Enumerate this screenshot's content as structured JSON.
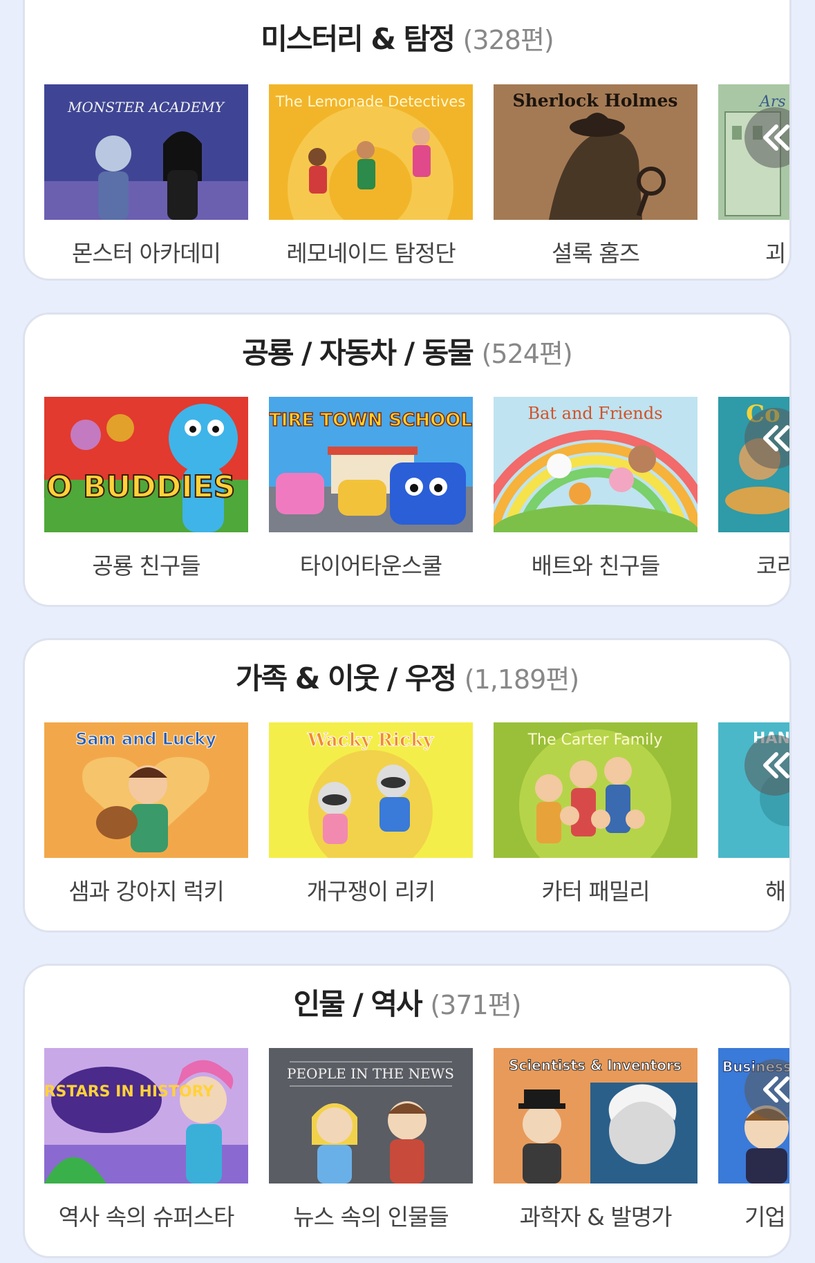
{
  "sections": [
    {
      "title": "미스터리 & 탐정",
      "count": "(328편)",
      "items": [
        {
          "label": "몬스터 아카데미",
          "thumb_text": "MONSTER ACADEMY"
        },
        {
          "label": "레모네이드 탐정단",
          "thumb_text": "The Lemonade Detectives"
        },
        {
          "label": "셜록 홈즈",
          "thumb_text": "Sherlock Holmes"
        },
        {
          "label": "괴",
          "thumb_text": "Ars"
        }
      ]
    },
    {
      "title": "공룡 / 자동차 / 동물",
      "count": "(524편)",
      "items": [
        {
          "label": "공룡 친구들",
          "thumb_text": "DINO BUDDIES"
        },
        {
          "label": "타이어타운스쿨",
          "thumb_text": "TIRE TOWN SCHOOL"
        },
        {
          "label": "배트와 친구들",
          "thumb_text": "Bat and Friends"
        },
        {
          "label": "코리",
          "thumb_text": "Co"
        }
      ]
    },
    {
      "title": "가족 & 이웃 / 우정",
      "count": "(1,189편)",
      "items": [
        {
          "label": "샘과 강아지 럭키",
          "thumb_text": "Sam and Lucky"
        },
        {
          "label": "개구쟁이 리키",
          "thumb_text": "Wacky Ricky"
        },
        {
          "label": "카터 패밀리",
          "thumb_text": "The Carter Family"
        },
        {
          "label": "해",
          "thumb_text": "HAN"
        }
      ]
    },
    {
      "title": "인물 / 역사",
      "count": "(371편)",
      "items": [
        {
          "label": "역사 속의 슈퍼스타",
          "thumb_text": "SUPERSTARS IN HISTORY"
        },
        {
          "label": "뉴스 속의 인물들",
          "thumb_text": "PEOPLE IN THE NEWS"
        },
        {
          "label": "과학자 & 발명가",
          "thumb_text": "Scientists & Inventors"
        },
        {
          "label": "기업",
          "thumb_text": "Business"
        }
      ]
    }
  ],
  "colors": {
    "background": "#e9eefc",
    "card": "#ffffff",
    "title": "#222222",
    "count": "#888888",
    "label": "#444444"
  },
  "icons": {
    "prev_button": "double-chevron-left-icon"
  }
}
